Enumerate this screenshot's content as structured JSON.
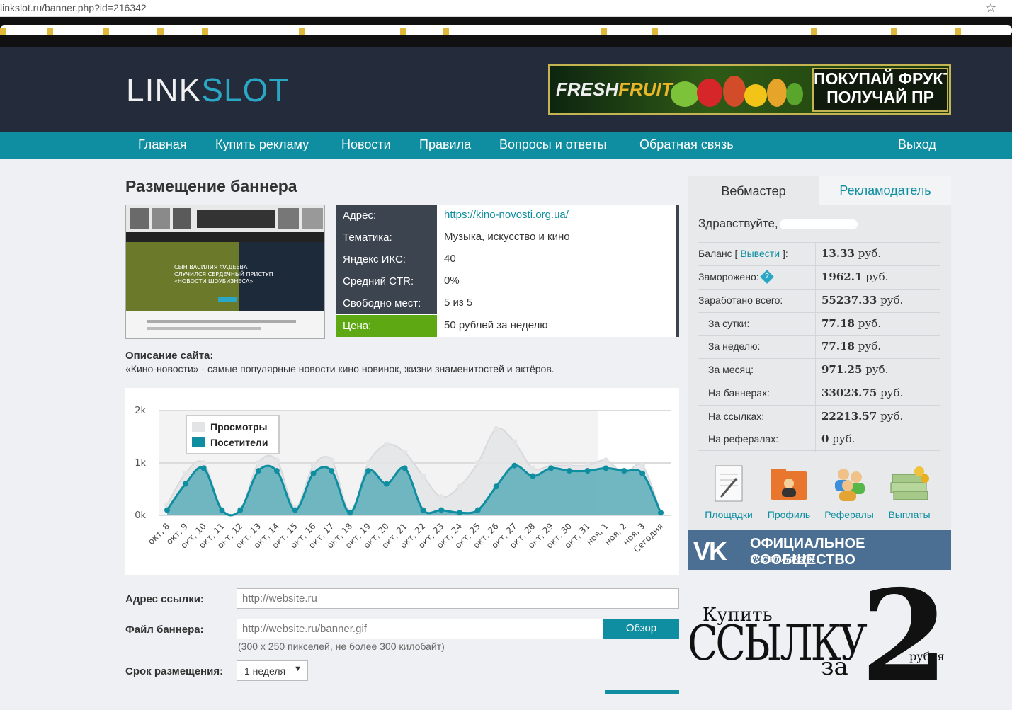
{
  "browser": {
    "url": "linkslot.ru/banner.php?id=216342"
  },
  "header": {
    "logo_link": "LINK",
    "logo_slot": "SLOT",
    "ad": {
      "fresh": "FRESH",
      "fruit": "FRUIT",
      "promo_line1": "ПОКУПАЙ ФРУКТЫ",
      "promo_line2": "ПОЛУЧАЙ ПР"
    }
  },
  "nav": {
    "items": [
      {
        "label": "Главная"
      },
      {
        "label": "Купить рекламу"
      },
      {
        "label": "Новости"
      },
      {
        "label": "Правила"
      },
      {
        "label": "Вопросы и ответы"
      },
      {
        "label": "Обратная связь"
      }
    ],
    "logout": "Выход"
  },
  "main": {
    "title": "Размещение баннера",
    "thumb_text": "СЫН ВАСИЛИЯ ФАДЕЕВА СЛУЧИЛСЯ СЕРДЕЧНЫЙ ПРИСТУП «НОВОСТИ ШОУБИЗНЕСА»",
    "info": [
      {
        "key": "Адрес:",
        "value": "https://kino-novosti.org.ua/",
        "link": true
      },
      {
        "key": "Тематика:",
        "value": "Музыка, искусство и кино"
      },
      {
        "key": "Яндекс ИКС:",
        "value": "40"
      },
      {
        "key": "Средний CTR:",
        "value": "0%"
      },
      {
        "key": "Свободно мест:",
        "value": "5 из 5"
      },
      {
        "key": "Цена:",
        "value": "50 рублей за неделю",
        "price": true
      }
    ],
    "description_heading": "Описание сайта:",
    "description": "«Кино-новости» - самые популярные новости кино новинок, жизни знаменитостей и актёров."
  },
  "chart_data": {
    "type": "area",
    "categories": [
      "окт, 8",
      "окт, 9",
      "окт, 10",
      "окт, 11",
      "окт, 12",
      "окт, 13",
      "окт, 14",
      "окт, 15",
      "окт, 16",
      "окт, 17",
      "окт, 18",
      "окт, 19",
      "окт, 20",
      "окт, 21",
      "окт, 22",
      "окт, 23",
      "окт, 24",
      "окт, 25",
      "окт, 26",
      "окт, 27",
      "окт, 28",
      "окт, 29",
      "окт, 30",
      "окт, 31",
      "ноя, 1",
      "ноя, 2",
      "ноя, 3",
      "Сегодня"
    ],
    "yticks": [
      "0k",
      "1k",
      "2k"
    ],
    "ylim": [
      0,
      2000
    ],
    "legend_position": "top-left",
    "series": [
      {
        "name": "Просмотры",
        "color": "#e3e4e6",
        "values": [
          200,
          800,
          1000,
          100,
          100,
          1000,
          1050,
          150,
          950,
          1050,
          80,
          1000,
          1350,
          1200,
          750,
          350,
          550,
          1000,
          1650,
          1400,
          900,
          950,
          950,
          950,
          1050,
          800,
          950,
          50
        ]
      },
      {
        "name": "Посетители",
        "color": "#0e8ea0",
        "values": [
          100,
          600,
          900,
          100,
          100,
          850,
          850,
          100,
          800,
          850,
          50,
          850,
          600,
          900,
          100,
          100,
          50,
          100,
          550,
          950,
          750,
          900,
          850,
          850,
          900,
          850,
          800,
          50
        ]
      }
    ]
  },
  "form": {
    "link_label": "Адрес ссылки:",
    "link_placeholder": "http://website.ru",
    "file_label": "Файл баннера:",
    "file_placeholder": "http://website.ru/banner.gif",
    "browse": "Обзор",
    "file_hint": "(300 x 250 пикселей, не более 300 килобайт)",
    "term_label": "Срок размещения:",
    "term_value": "1 неделя"
  },
  "sidebar": {
    "tab_webmaster": "Вебмастер",
    "tab_advertiser": "Рекламодатель",
    "greeting": "Здравствуйте,",
    "balance_label_pre": "Баланс [",
    "balance_withdraw": "Вывести",
    "balance_label_post": "]:",
    "rows": [
      {
        "label": "Заморожено:",
        "amount": "1962.1",
        "unit": "руб.",
        "info": true
      },
      {
        "label": "Заработано всего:",
        "amount": "55237.33",
        "unit": "руб."
      },
      {
        "label": "За сутки:",
        "amount": "77.18",
        "unit": "руб.",
        "indent": true
      },
      {
        "label": "За неделю:",
        "amount": "77.18",
        "unit": "руб.",
        "indent": true
      },
      {
        "label": "За месяц:",
        "amount": "971.25",
        "unit": "руб.",
        "indent": true
      },
      {
        "label": "На баннерах:",
        "amount": "33023.75",
        "unit": "руб.",
        "indent": true
      },
      {
        "label": "На ссылках:",
        "amount": "22213.57",
        "unit": "руб.",
        "indent": true
      },
      {
        "label": "На рефералах:",
        "amount": "0",
        "unit": "руб.",
        "indent": true
      }
    ],
    "balance_amount": "13.33",
    "balance_unit": "руб.",
    "info_icon": "?",
    "icons": [
      {
        "label": "Площадки",
        "icon": "notepad-icon"
      },
      {
        "label": "Профиль",
        "icon": "folder-profile-icon"
      },
      {
        "label": "Рефералы",
        "icon": "users-icon"
      },
      {
        "label": "Выплаты",
        "icon": "money-icon"
      }
    ],
    "vk": {
      "logo": "VK",
      "title": "ОФИЦИАЛЬНОЕ СООБЩЕСТВО",
      "url": "vk.com/linkslot"
    },
    "promo": {
      "buy": "Купить",
      "link": "ССЫЛКУ",
      "za": "за",
      "two": "2",
      "rub": "рубля"
    }
  }
}
